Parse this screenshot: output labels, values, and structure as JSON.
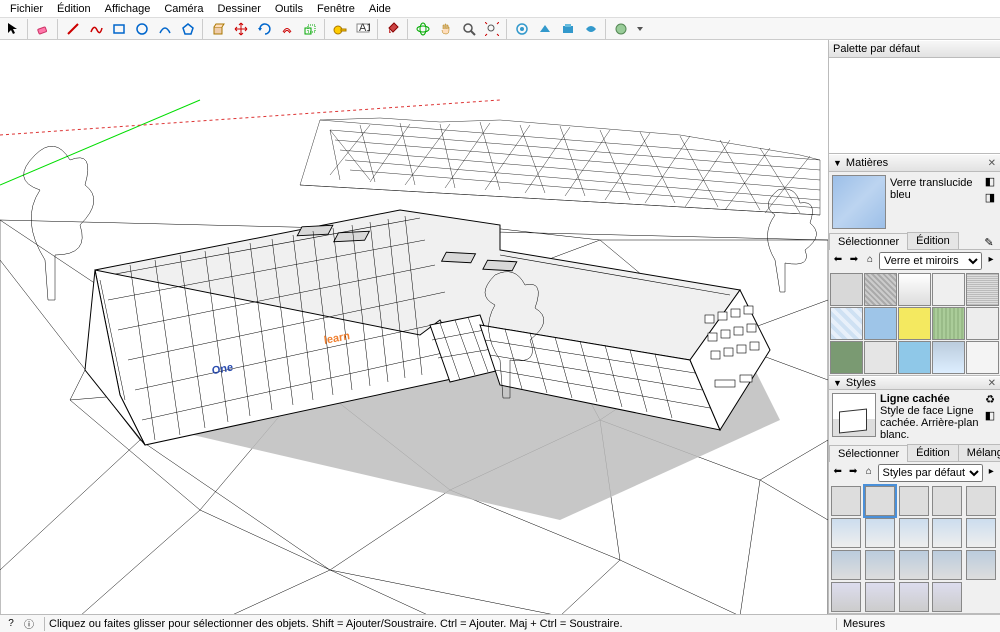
{
  "menu": {
    "items": [
      "Fichier",
      "Édition",
      "Affichage",
      "Caméra",
      "Dessiner",
      "Outils",
      "Fenêtre",
      "Aide"
    ]
  },
  "palette_default": "Palette par défaut",
  "materials": {
    "title": "Matières",
    "current_name": "Verre translucide bleu",
    "tab_select": "Sélectionner",
    "tab_edit": "Édition",
    "dropdown": "Verre et miroirs",
    "swatch_colors": [
      "#d8d8d8",
      "#c8c8c8",
      "#f2f2f2",
      "#efefef",
      "#d0d0d0",
      "#cfe1f3",
      "#9ec5e8",
      "#f4e960",
      "#c8d8c0",
      "#ededed",
      "#96b38e",
      "#e5e5e5",
      "#8fc8e8",
      "#d9e4ee",
      "#f4f4f4"
    ]
  },
  "styles": {
    "title": "Styles",
    "name": "Ligne cachée",
    "desc": "Style de face Ligne cachée. Arrière-plan blanc.",
    "tab_select": "Sélectionner",
    "tab_edit": "Édition",
    "tab_mix": "Mélange",
    "dropdown": "Styles par défaut"
  },
  "status": {
    "hint": "Cliquez ou faites glisser pour sélectionner des objets. Shift = Ajouter/Soustraire. Ctrl = Ajouter. Maj + Ctrl = Soustraire.",
    "measures_label": "Mesures"
  },
  "logo": {
    "part1": "One",
    "part2": "learn"
  }
}
